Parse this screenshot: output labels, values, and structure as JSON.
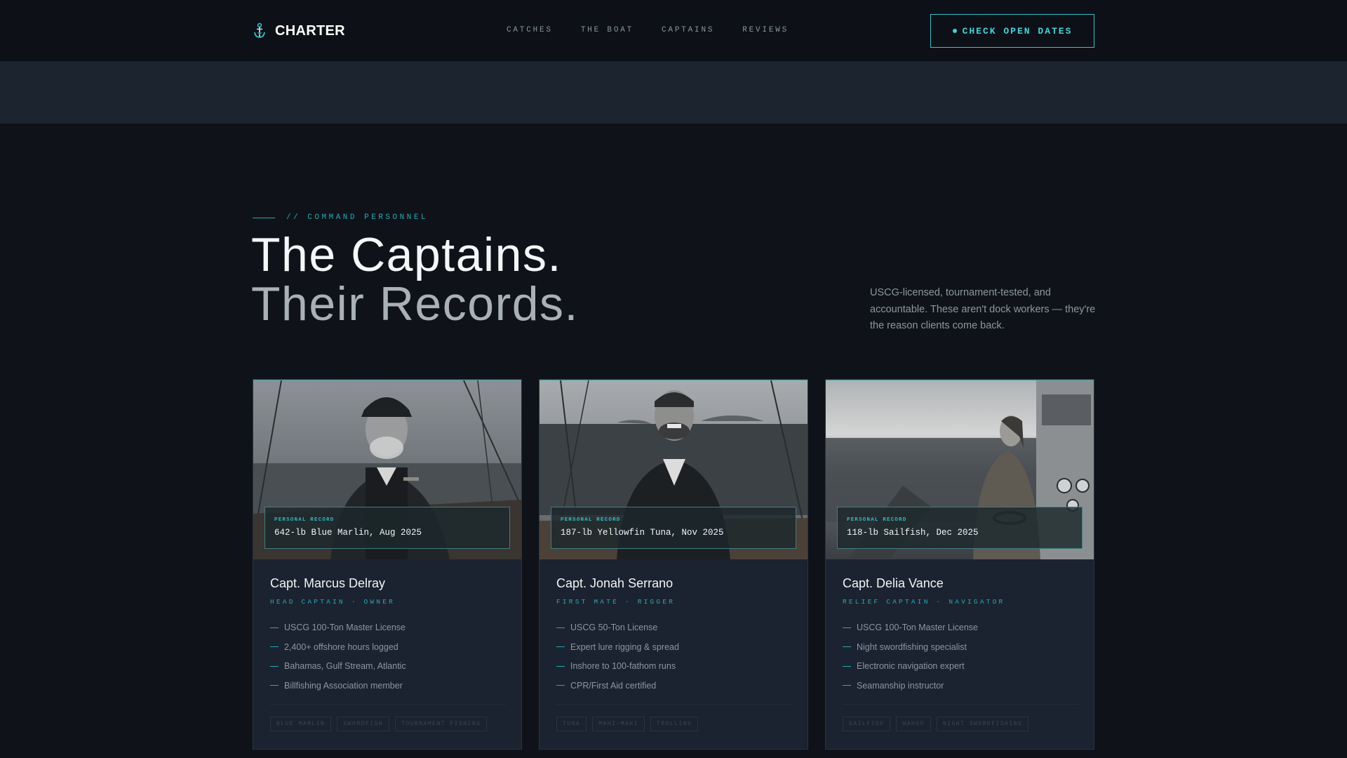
{
  "nav": {
    "brand": "CHARTER",
    "brand_icon": "anchor-icon",
    "links": [
      "CATCHES",
      "THE BOAT",
      "CAPTAINS",
      "REVIEWS"
    ],
    "cta": "CHECK OPEN DATES"
  },
  "section": {
    "eyebrow": "// COMMAND PERSONNEL",
    "title_line1": "The Captains.",
    "title_line2": "Their Records.",
    "lead": "USCG-licensed, tournament-tested, and accountable. These aren't dock workers — they're the reason clients come back."
  },
  "cards": [
    {
      "record_label": "PERSONAL RECORD",
      "record": "642-lb Blue Marlin, Aug 2025",
      "name": "Capt. Marcus Delray",
      "role": "HEAD CAPTAIN · OWNER",
      "quals": [
        "USCG 100-Ton Master License",
        "2,400+ offshore hours logged",
        "Bahamas, Gulf Stream, Atlantic",
        "Billfishing Association member"
      ],
      "tags": [
        "BLUE MARLIN",
        "SWORDFISH",
        "TOURNAMENT FISHING"
      ]
    },
    {
      "record_label": "PERSONAL RECORD",
      "record": "187-lb Yellowfin Tuna, Nov 2025",
      "name": "Capt. Jonah Serrano",
      "role": "FIRST MATE · RIGGER",
      "quals": [
        "USCG 50-Ton License",
        "Expert lure rigging & spread",
        "Inshore to 100-fathom runs",
        "CPR/First Aid certified"
      ],
      "tags": [
        "TUNA",
        "MAHI-MAHI",
        "TROLLING"
      ]
    },
    {
      "record_label": "PERSONAL RECORD",
      "record": "118-lb Sailfish, Dec 2025",
      "name": "Capt. Delia Vance",
      "role": "RELIEF CAPTAIN · NAVIGATOR",
      "quals": [
        "USCG 100-Ton Master License",
        "Night swordfishing specialist",
        "Electronic navigation expert",
        "Seamanship instructor"
      ],
      "tags": [
        "SAILFISH",
        "WAHOO",
        "NIGHT SWORDFISHING"
      ]
    }
  ],
  "colors": {
    "accent": "#2aa9b3",
    "background": "#0f1319",
    "card": "#1b2230"
  }
}
